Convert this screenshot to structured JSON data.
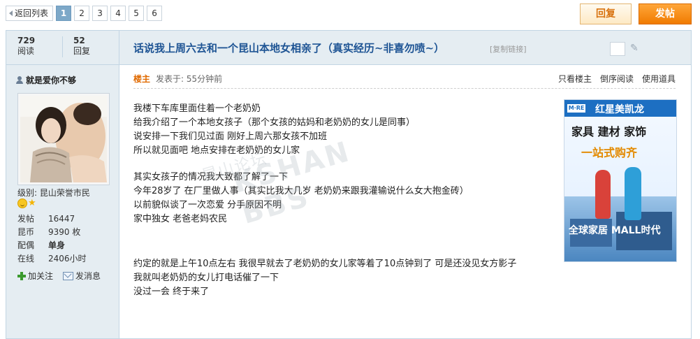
{
  "pager": {
    "back_label": "返回列表",
    "pages": [
      "1",
      "2",
      "3",
      "4",
      "5",
      "6"
    ],
    "current": "1"
  },
  "toolbar": {
    "reply_label": "回复",
    "post_label": "发帖"
  },
  "stats": {
    "views_num": "729",
    "views_label": "阅读",
    "replies_num": "52",
    "replies_label": "回复"
  },
  "thread": {
    "title": "话说我上周六去和一个昆山本地女相亲了（真实经历~非喜勿喷~）",
    "copy_link": "[复制链接]"
  },
  "author": {
    "name": "就是爱你不够",
    "level": "级别: 昆山荣誉市民",
    "profile": [
      {
        "k": "发帖",
        "v": "16447"
      },
      {
        "k": "昆币",
        "v": "9390 枚"
      },
      {
        "k": "配偶",
        "v": "单身"
      },
      {
        "k": "在线",
        "v": "2406小时"
      }
    ],
    "follow_label": "加关注",
    "message_label": "发消息"
  },
  "post": {
    "floor": "楼主",
    "posted_at": "发表于: 55分钟前",
    "tools": [
      "只看楼主",
      "倒序阅读",
      "使用道具"
    ],
    "paragraphs": [
      [
        "我楼下车库里面住着一个老奶奶",
        "给我介绍了一个本地女孩子（那个女孩的姑妈和老奶奶的女儿是同事）",
        "说安排一下我们见过面 刚好上周六那女孩不加班",
        "所以就见面吧 地点安排在老奶奶的女儿家"
      ],
      [
        "其实女孩子的情况我大致都了解了一下",
        "今年28岁了 在厂里做人事（其实比我大几岁 老奶奶来跟我灌输说什么女大抱金砖）",
        "以前貌似谈了一次恋爱 分手原因不明",
        "家中独女 老爸老妈农民"
      ],
      [
        "约定的就是上午10点左右 我很早就去了老奶奶的女儿家等着了10点钟到了 可是还没见女方影子",
        "我就叫老奶奶的女儿打电话催了一下",
        "没过一会 终于来了"
      ]
    ]
  },
  "watermark": {
    "cn": "昆山论坛",
    "en": "KSHAN BBS"
  },
  "ad": {
    "logo": "M·RE",
    "brand": "红星美凯龙",
    "line1": "家具 建材 家饰",
    "line2": "一站式购齐",
    "slogan": "全球家居 MALL时代"
  }
}
